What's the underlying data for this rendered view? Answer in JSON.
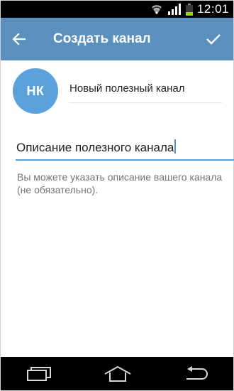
{
  "status_bar": {
    "time": "12:01",
    "battery_level": 0.3,
    "icons": [
      "wifi-icon",
      "signal-icon",
      "battery-icon"
    ]
  },
  "app_bar": {
    "title": "Создать канал",
    "back_icon": "arrow-left-icon",
    "done_icon": "check-icon"
  },
  "channel": {
    "avatar_initials": "НК",
    "name_value": "Новый полезный канал",
    "description_value": "Описание полезного канала",
    "description_hint": "Вы можете указать описание вашего канала (не обязательно)."
  },
  "nav_bar": {
    "icons": [
      "recent-apps-icon",
      "home-icon",
      "back-icon"
    ]
  },
  "colors": {
    "primary": "#5b8fbe",
    "avatar": "#5ba1dc",
    "hint_text": "#757575"
  }
}
